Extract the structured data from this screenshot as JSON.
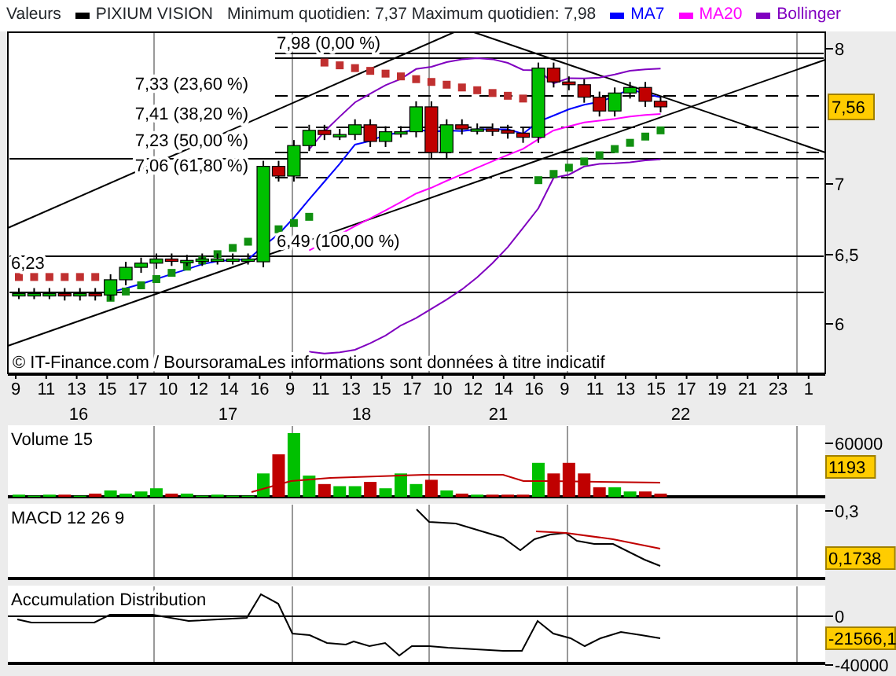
{
  "header": {
    "title": "Valeurs",
    "series": {
      "name": "PIXIUM VISION",
      "color": "#000000"
    },
    "stats": "Minimum quotidien: 7,37 Maximum quotidien: 7,98",
    "indicators": [
      {
        "name": "MA7",
        "color": "#0000ff"
      },
      {
        "name": "MA20",
        "color": "#ff00ff"
      },
      {
        "name": "Bollinger",
        "color": "#8000c0"
      }
    ]
  },
  "price_chart": {
    "fib_labels": [
      "7,98 (0,00 %)",
      "7,33 (23,60 %)",
      "7,41 (38,20 %)",
      "7,23 (50,00 %)",
      "7,06 (61,80 %)",
      "6,49 (100,00 %)"
    ],
    "start_label": "6,23",
    "y_axis": [
      "8",
      "7",
      "6,5",
      "6"
    ],
    "price_badge": "7,56",
    "copyright": "© IT-Finance.com / BoursoramaLes informations sont données à titre indicatif"
  },
  "x_axis": {
    "hours": [
      "9",
      "11",
      "13",
      "15",
      "17",
      "10",
      "12",
      "14",
      "16",
      "9",
      "11",
      "13",
      "15",
      "17",
      "10",
      "12",
      "14",
      "16",
      "9",
      "11",
      "13",
      "15",
      "17",
      "19",
      "21",
      "23",
      "1"
    ],
    "days": [
      "16",
      "17",
      "18",
      "21",
      "22"
    ]
  },
  "volume": {
    "title": "Volume 15",
    "y_axis": [
      "60000"
    ],
    "badge": "1193"
  },
  "macd": {
    "title": "MACD 12 26 9",
    "y_axis": [
      "0,3"
    ],
    "badge": "0,1738"
  },
  "accumulation": {
    "title": "Accumulation Distribution",
    "y_axis": [
      "0",
      "-40000"
    ],
    "badge": "-21566,1"
  }
}
